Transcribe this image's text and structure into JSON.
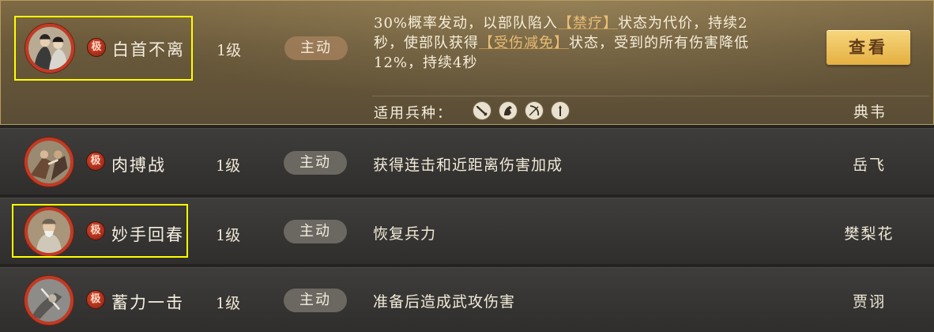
{
  "skills": [
    {
      "portrait": "portrait-couple",
      "tier": "极",
      "name": "白首不离",
      "level": "1级",
      "type": "主动",
      "desc_parts": {
        "p1": "30%概率发动，以部队陷入",
        "h1": "【禁疗】",
        "p2": "状态为代价，持续2秒，使部队获得",
        "h2": "【受伤减免】",
        "p3": "状态，受到的所有伤害降低12%，持续4秒"
      },
      "troops_label": "适用兵种：",
      "troop_icons": [
        "sword-icon",
        "horse-icon",
        "bow-icon",
        "spear-icon"
      ],
      "view_label": "查看",
      "hero": "典韦"
    },
    {
      "portrait": "portrait-brawl",
      "tier": "极",
      "name": "肉搏战",
      "level": "1级",
      "type": "主动",
      "desc": "获得连击和近距离伤害加成",
      "hero": "岳飞"
    },
    {
      "portrait": "portrait-healer",
      "tier": "极",
      "name": "妙手回春",
      "level": "1级",
      "type": "主动",
      "desc": "恢复兵力",
      "hero": "樊梨花"
    },
    {
      "portrait": "portrait-strike",
      "tier": "极",
      "name": "蓄力一击",
      "level": "1级",
      "type": "主动",
      "desc": "准备后造成武攻伤害",
      "hero": "贾诩"
    }
  ],
  "colors": {
    "highlight_box": "#ffff00",
    "tier_badge": "#c23a24",
    "view_button": "#e4ae3e",
    "keyword": "#e7b76b"
  }
}
